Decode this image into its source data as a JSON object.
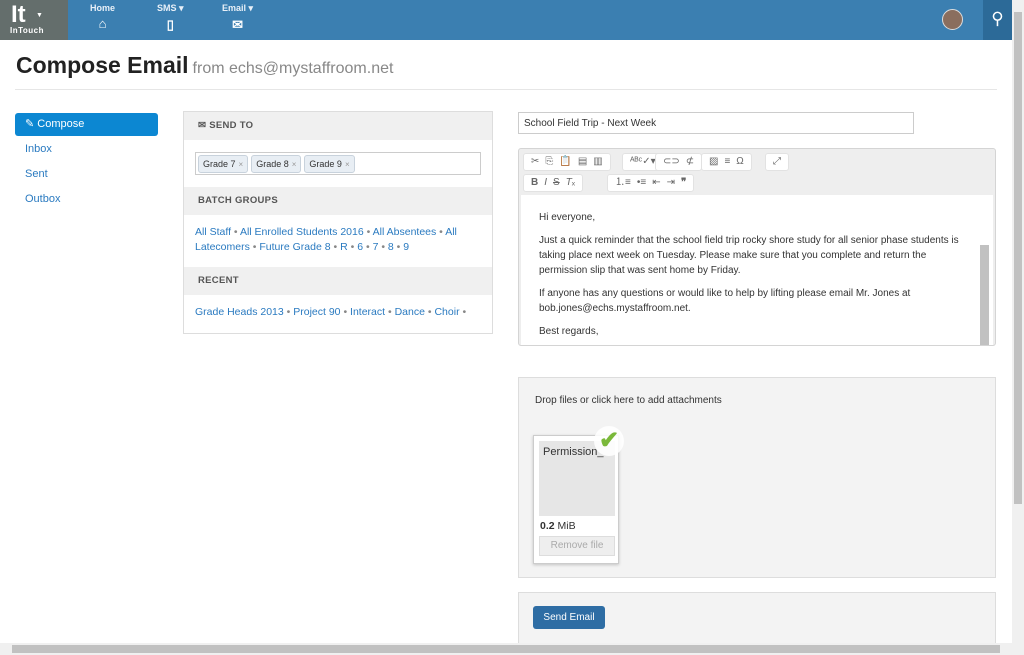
{
  "nav": {
    "logo": "It",
    "brand": "InTouch",
    "items": [
      {
        "label": "Home",
        "icon": "home-icon"
      },
      {
        "label": "SMS ▾",
        "icon": "mobile-icon"
      },
      {
        "label": "Email ▾",
        "icon": "envelope-icon"
      }
    ],
    "search_icon": "search-icon"
  },
  "header": {
    "title": "Compose Email",
    "subtitle": "from echs@mystaffroom.net"
  },
  "sidebar": {
    "items": [
      {
        "label": "✎ Compose",
        "active": true
      },
      {
        "label": "Inbox"
      },
      {
        "label": "Sent"
      },
      {
        "label": "Outbox"
      }
    ]
  },
  "recipients": {
    "send_to_title": "SEND TO",
    "tags": [
      "Grade 7",
      "Grade 8",
      "Grade 9"
    ],
    "batch_title": "BATCH GROUPS",
    "batch_groups": [
      "All Staff",
      "All Enrolled Students 2016",
      "All Absentees",
      "All Latecomers",
      "Future Grade 8",
      "R",
      "6",
      "7",
      "8",
      "9"
    ],
    "recent_title": "RECENT",
    "recent": [
      "Grade Heads 2013",
      "Project 90",
      "Interact",
      "Dance",
      "Choir"
    ]
  },
  "compose": {
    "subject": "School Field Trip - Next Week",
    "body": [
      "Hi everyone,",
      "Just a quick reminder that the school field trip rocky shore study for all senior phase students is taking place next week on Tuesday.  Please make sure that you complete and return the permission slip that was sent home by Friday.",
      "If anyone has any questions or would like to help by lifting please email Mr. Jones at bob.jones@echs.mystaffroom.net.",
      "Best regards,"
    ]
  },
  "attachments": {
    "prompt": "Drop files or click here to add attachments",
    "file": {
      "name": "Permission_",
      "size_value": "0.2",
      "size_unit": "MiB",
      "remove_label": "Remove file"
    }
  },
  "send_label": "Send Email",
  "colors": {
    "nav": "#3b7fb1",
    "accent": "#0c87d2",
    "success": "#7ab83a"
  }
}
